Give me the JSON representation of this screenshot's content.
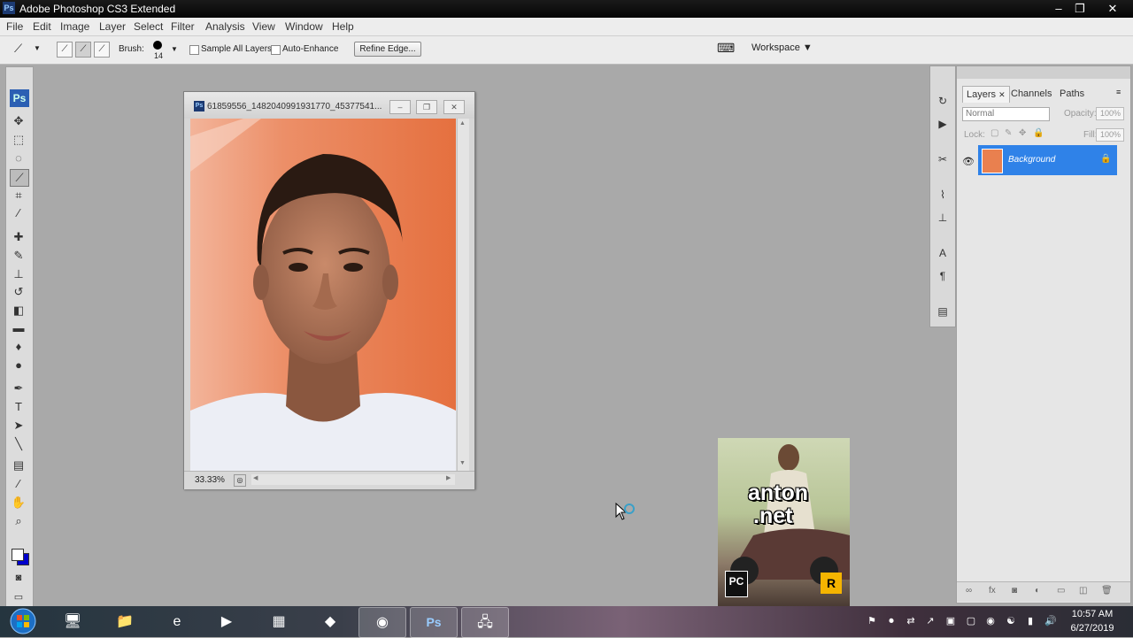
{
  "app": {
    "title": "Adobe Photoshop CS3 Extended",
    "logo": "Ps"
  },
  "window_controls": {
    "minimize": "–",
    "maximize": "❐",
    "close": "✕"
  },
  "menu": [
    "File",
    "Edit",
    "Image",
    "Layer",
    "Select",
    "Filter",
    "Analysis",
    "View",
    "Window",
    "Help"
  ],
  "options_bar": {
    "brush_label": "Brush:",
    "brush_size": "14",
    "sample_all_layers": "Sample All Layers",
    "auto_enhance": "Auto-Enhance",
    "refine_edge": "Refine Edge...",
    "workspace": "Workspace ▼"
  },
  "toolbox": {
    "logo": "Ps",
    "tools": [
      {
        "name": "move-tool-icon",
        "glyph": "✥"
      },
      {
        "name": "marquee-tool-icon",
        "glyph": "⬚"
      },
      {
        "name": "lasso-tool-icon",
        "glyph": "◌"
      },
      {
        "name": "quick-selection-tool-icon",
        "glyph": "⟋"
      },
      {
        "name": "crop-tool-icon",
        "glyph": "⌗"
      },
      {
        "name": "slice-tool-icon",
        "glyph": "⁄"
      },
      {
        "name": "healing-brush-icon",
        "glyph": "✚"
      },
      {
        "name": "brush-tool-icon",
        "glyph": "✎"
      },
      {
        "name": "clone-stamp-icon",
        "glyph": "⊥"
      },
      {
        "name": "history-brush-icon",
        "glyph": "↺"
      },
      {
        "name": "eraser-tool-icon",
        "glyph": "◧"
      },
      {
        "name": "gradient-tool-icon",
        "glyph": "▬"
      },
      {
        "name": "blur-tool-icon",
        "glyph": "♦"
      },
      {
        "name": "dodge-tool-icon",
        "glyph": "●"
      },
      {
        "name": "pen-tool-icon",
        "glyph": "✒"
      },
      {
        "name": "type-tool-icon",
        "glyph": "T"
      },
      {
        "name": "path-selection-icon",
        "glyph": "➤"
      },
      {
        "name": "line-tool-icon",
        "glyph": "╲"
      },
      {
        "name": "notes-tool-icon",
        "glyph": "▤"
      },
      {
        "name": "eyedropper-icon",
        "glyph": "⁄"
      },
      {
        "name": "hand-tool-icon",
        "glyph": "✋"
      },
      {
        "name": "zoom-tool-icon",
        "glyph": "⌕"
      }
    ]
  },
  "document": {
    "title": "61859556_1482040991931770_45377541...",
    "zoom": "33.33%"
  },
  "layers_panel": {
    "tabs": [
      "Layers",
      "Channels",
      "Paths"
    ],
    "blend_mode": "Normal",
    "opacity_label": "Opacity:",
    "opacity_value": "100%",
    "lock_label": "Lock:",
    "fill_label": "Fill:",
    "fill_value": "100%",
    "layers": [
      {
        "name": "Background"
      }
    ]
  },
  "box_art": {
    "line1": "anton",
    "line2": ".net",
    "pc": "PC",
    "r": "R"
  },
  "taskbar": {
    "apps": [
      {
        "name": "taskbar-computer-icon",
        "glyph": "🖥"
      },
      {
        "name": "taskbar-folder-icon",
        "glyph": "📁"
      },
      {
        "name": "taskbar-ie-icon",
        "glyph": "e"
      },
      {
        "name": "taskbar-media-icon",
        "glyph": "▶"
      },
      {
        "name": "taskbar-app-icon",
        "glyph": "▦"
      },
      {
        "name": "taskbar-garena-icon",
        "glyph": "◆"
      },
      {
        "name": "taskbar-chrome-icon",
        "glyph": "◉"
      },
      {
        "name": "taskbar-photoshop-icon",
        "glyph": "Ps"
      },
      {
        "name": "taskbar-network-icon",
        "glyph": "🖧"
      }
    ],
    "time": "10:57 AM",
    "date": "6/27/2019"
  },
  "colors": {
    "selection": "#2f82e8",
    "workspace": "#a9a9a9"
  }
}
